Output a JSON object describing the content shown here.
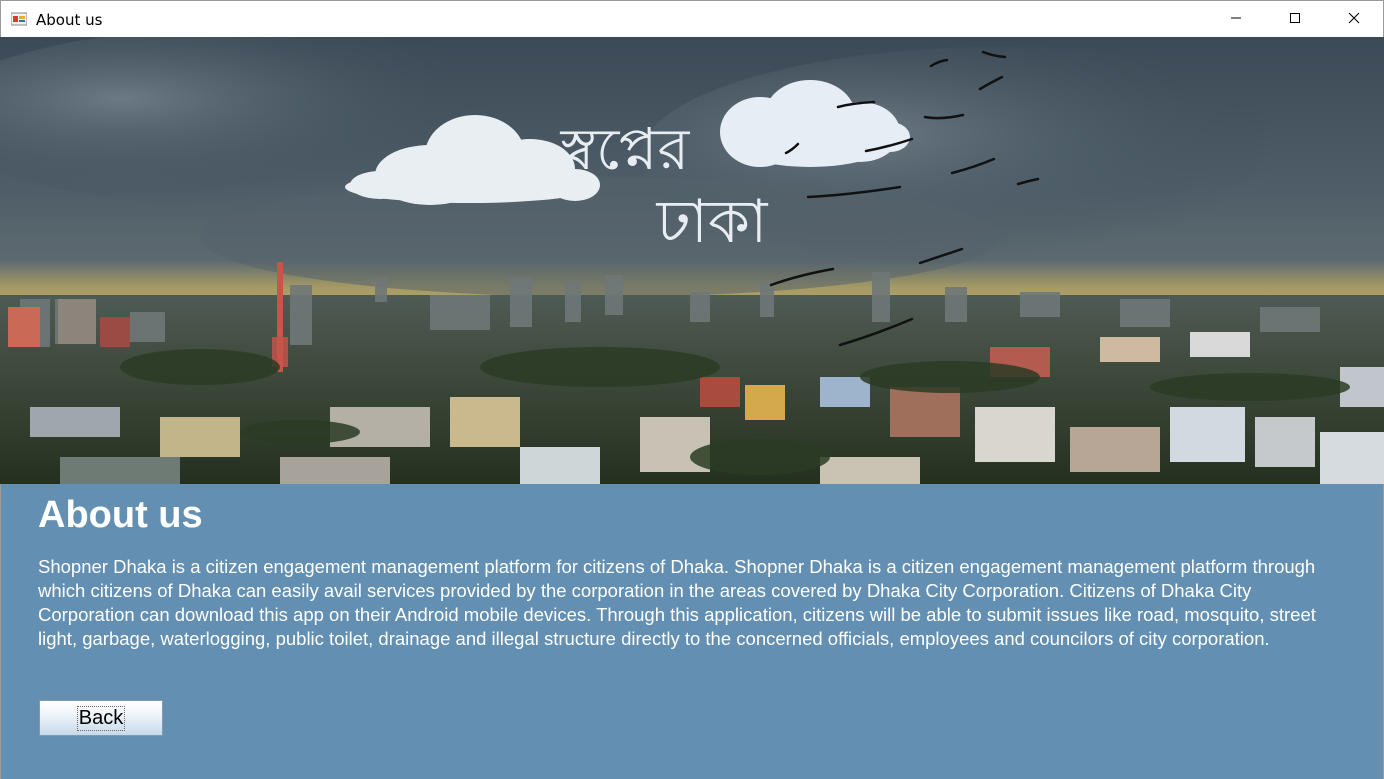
{
  "window": {
    "title": "About us",
    "icon": "app-icon",
    "controls": {
      "minimize": "minimize-icon",
      "maximize": "maximize-icon",
      "close": "close-icon"
    }
  },
  "banner": {
    "image": "dhaka-skyline-banner",
    "logo_line1": "স্বপ্নের",
    "logo_line2": "ঢাকা"
  },
  "main": {
    "heading": "About us",
    "description": "Shopner Dhaka is a citizen engagement management platform for citizens of Dhaka. Shopner Dhaka is a citizen engagement management platform through which citizens of Dhaka can easily avail services provided by the corporation in the areas covered by Dhaka City Corporation. Citizens of Dhaka City Corporation can download this app on their Android mobile devices. Through this application, citizens will be able to submit issues like road, mosquito, street light, garbage, waterlogging, public toilet, drainage and illegal structure directly to the concerned officials, employees and councilors of city corporation.",
    "back_label": "Back"
  },
  "colors": {
    "content_background": "#6390b2",
    "text": "#ffffff"
  }
}
